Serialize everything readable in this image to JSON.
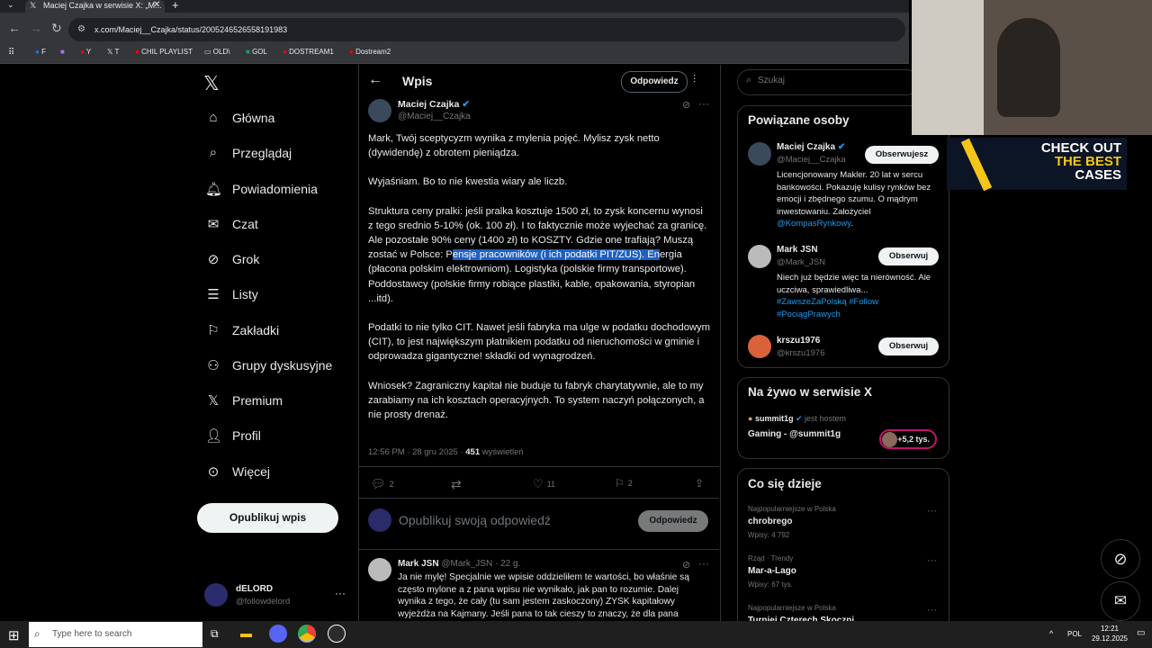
{
  "browser": {
    "tab_title": "Maciej Czajka w serwisie X: „M...",
    "url": "x.com/Maciej__Czajka/status/2005246526558191983",
    "bookmarks": [
      "F",
      "Y",
      "T",
      "CHIL PLAYLIST",
      "OLD\\",
      "GOL",
      "DOSTREAM1",
      "Dostream2"
    ]
  },
  "sidebar": {
    "items": [
      {
        "label": "Główna",
        "icon": "home-icon"
      },
      {
        "label": "Przeglądaj",
        "icon": "search-icon"
      },
      {
        "label": "Powiadomienia",
        "icon": "bell-icon"
      },
      {
        "label": "Czat",
        "icon": "mail-icon"
      },
      {
        "label": "Grok",
        "icon": "grok-icon"
      },
      {
        "label": "Listy",
        "icon": "list-icon"
      },
      {
        "label": "Zakładki",
        "icon": "bookmark-icon"
      },
      {
        "label": "Grupy dyskusyjne",
        "icon": "community-icon"
      },
      {
        "label": "Premium",
        "icon": "x-logo-icon"
      },
      {
        "label": "Profil",
        "icon": "person-icon"
      },
      {
        "label": "Więcej",
        "icon": "more-circle-icon"
      }
    ],
    "post_button": "Opublikuj wpis",
    "account": {
      "name": "dELORD",
      "handle": "@followdelord"
    }
  },
  "header": {
    "title": "Wpis",
    "reply_button": "Odpowiedz"
  },
  "tweet": {
    "author": "Maciej Czajka",
    "handle": "@Maciej__Czajka",
    "p1": "Mark, Twój sceptycyzm wynika z mylenia pojęć. Mylisz zysk netto (dywidendę) z obrotem pieniądza.",
    "p2": "Wyjaśniam. Bo to nie kwestia wiary ale liczb.",
    "p3a": "Struktura ceny pralki: jeśli pralka kosztuje 1500 zł, to zysk koncernu wynosi z tego srednio 5-10% (ok. 100 zł). I to faktycznie może wyjechać za granicę. Ale pozostałe 90% ceny (1400 zł) to KOSZTY. Gdzie one trafiają? Muszą zostać w Polsce: P",
    "p3b": "ensje pracowników (i ich podatki PIT/ZUS). En",
    "p3c": "ergia (płacona polskim elektrowniom). Logistyka (polskie firmy transportowe). Poddostawcy (polskie firmy robiące plastiki, kable, opakowania, styropian ...itd).",
    "p4": "Podatki to nie tylko CIT. Nawet jeśli fabryka ma ulge w podatku dochodowym (CIT), to jest największym płatnikiem podatku od nieruchomości w gminie i odprowadza gigantyczne! składki od wynagrodzeń.",
    "p5": "Wniosek? Zagraniczny kapitał nie buduje tu fabryk charytatywnie, ale to my zarabiamy na ich kosztach operacyjnych. To system naczyń połączonych, a nie prosty drenaż.",
    "time": "12:56 PM · 28 gru 2025 · ",
    "views": "451",
    "views_label": " wyświetleń",
    "replies": "2",
    "likes": "11",
    "bookmarks": "2"
  },
  "reply_box": {
    "placeholder": "Opublikuj swoją odpowiedź",
    "button": "Odpowiedz"
  },
  "reply": {
    "author": "Mark JSN",
    "handle": "@Mark_JSN · 22 g.",
    "text": "Ja nie mylę! Specjalnie we wpisie oddzieliłem te wartości, bo właśnie są często mylone a z pana wpisu nie wynikało, jak pan to rozumie. Dalej wynika z tego, że cały (tu sam jestem zaskoczony) ZYSK kapitałowy wyjeżdża na Kajmany. Jeśli pana to tak cieszy to znaczy, że dla pana"
  },
  "right": {
    "search_placeholder": "Szukaj",
    "related_title": "Powiązane osoby",
    "people": [
      {
        "name": "Maciej Czajka",
        "handle": "@Maciej__Czajka",
        "button": "Obserwujesz",
        "bio": "Licencjonowany Makler. 20 lat w sercu bankowości. Pokazuję kulisy rynków bez emocji i zbędnego szumu. O mądrym inwestowaniu. Założyciel ",
        "bio_link": "@KompasRynkowy",
        "bio_end": "."
      },
      {
        "name": "Mark JSN",
        "handle": "@Mark_JSN",
        "button": "Obserwuj",
        "bio": "Niech już będzie więc ta nierówność. Ale uczciwa, sprawiedliwa...",
        "tags": "#ZawszeZaPolską #Follow #PociągPrawych"
      },
      {
        "name": "krszu1976",
        "handle": "@krszu1976",
        "button": "Obserwuj"
      }
    ],
    "live_title": "Na żywo w serwisie X",
    "live_host": "summit1g",
    "live_host_suffix": " jest hostem",
    "live_name": "Gaming - @summit1g",
    "live_count": "+5,2 tys.",
    "trends_title": "Co się dzieje",
    "trends": [
      {
        "context": "Najpopularniejsze w Polska",
        "name": "chrobrego",
        "count": "Wpisy: 4 792"
      },
      {
        "context": "Rząd · Trendy",
        "name": "Mar-a-Lago",
        "count": "Wpisy: 67 tys."
      },
      {
        "context": "Najpopularniejsze w Polska",
        "name": "Turniej Czterech Skoczni",
        "count": ""
      }
    ]
  },
  "overlay": {
    "banner_line1": "CHECK OUT",
    "banner_line2": "THE BEST",
    "banner_line3": "CASES"
  },
  "taskbar": {
    "search": "Type here to search",
    "lang": "POL",
    "time": "12:21",
    "date": "29.12.2025"
  },
  "colors": {
    "accent": "#1d9bf0",
    "highlight": "#1f60c4",
    "background": "#000000",
    "banner_yellow": "#f5c518"
  }
}
